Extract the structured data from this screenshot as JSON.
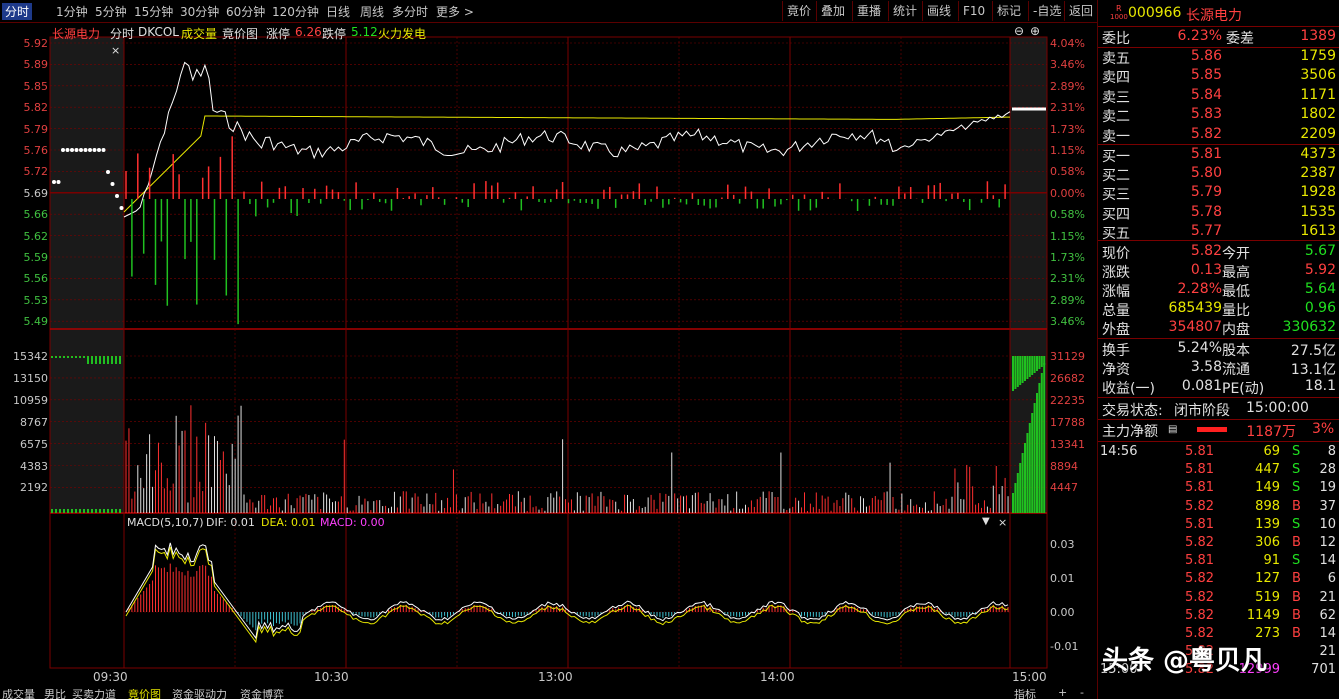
{
  "toolbar": {
    "periods": [
      "分时",
      "1分钟",
      "5分钟",
      "15分钟",
      "30分钟",
      "60分钟",
      "120分钟",
      "日线",
      "周线",
      "多分时",
      "更多 >"
    ],
    "buttons": [
      "竟价",
      "叠加",
      "重播",
      "统计",
      "画线",
      "F10",
      "标记",
      "-自选",
      "返回"
    ]
  },
  "chart_header": {
    "stock_name": "长源电力",
    "mode": "分时",
    "indicator": "DKCOL",
    "vol_label": "成交量",
    "bid_label": "竟价图",
    "limit_up_label": "涨停",
    "limit_up_value": "6.26",
    "limit_down_label": "跌停",
    "limit_down_value": "5.12",
    "concept": "火力发电"
  },
  "price_axis": {
    "left": [
      "5.92",
      "5.89",
      "5.85",
      "5.82",
      "5.79",
      "5.76",
      "5.72",
      "5.69",
      "5.66",
      "5.62",
      "5.59",
      "5.56",
      "5.53",
      "5.49"
    ],
    "right": [
      "4.04%",
      "3.46%",
      "2.89%",
      "2.31%",
      "1.73%",
      "1.15%",
      "0.58%",
      "0.00%",
      "0.58%",
      "1.15%",
      "1.73%",
      "2.31%",
      "2.89%",
      "3.46%"
    ]
  },
  "volume_axis": {
    "left": [
      "15342",
      "13150",
      "10959",
      "8767",
      "6575",
      "4383",
      "2192"
    ],
    "right": [
      "31129",
      "26682",
      "22235",
      "17788",
      "13341",
      "8894",
      "4447"
    ]
  },
  "macd": {
    "label": "MACD(5,10,7)",
    "dif": "DIF: 0.01",
    "dea": "DEA: 0.01",
    "macd": "MACD: 0.00",
    "axis": [
      "0.03",
      "0.01",
      "0.00",
      "-0.01"
    ]
  },
  "time_axis": [
    "09:30",
    "10:30",
    "13:00",
    "14:00",
    "15:00"
  ],
  "bottom_tabs": [
    "成交量",
    "男比",
    "买卖力道",
    "竟价图",
    "资金驱动力",
    "资金博弈"
  ],
  "bottom_right": [
    "指标",
    "+",
    "-"
  ],
  "panel": {
    "code": "000966",
    "name": "长源电力",
    "code_prefix": "R",
    "code_sub": "1000",
    "weibi_label": "委比",
    "weibi": "6.23%",
    "weicha_label": "委差",
    "weicha": "1389",
    "asks": [
      {
        "label": "卖五",
        "price": "5.86",
        "vol": "1759"
      },
      {
        "label": "卖四",
        "price": "5.85",
        "vol": "3506"
      },
      {
        "label": "卖三",
        "price": "5.84",
        "vol": "1171"
      },
      {
        "label": "卖二",
        "price": "5.83",
        "vol": "1802"
      },
      {
        "label": "卖一",
        "price": "5.82",
        "vol": "2209"
      }
    ],
    "bids": [
      {
        "label": "买一",
        "price": "5.81",
        "vol": "4373"
      },
      {
        "label": "买二",
        "price": "5.80",
        "vol": "2387"
      },
      {
        "label": "买三",
        "price": "5.79",
        "vol": "1928"
      },
      {
        "label": "买四",
        "price": "5.78",
        "vol": "1535"
      },
      {
        "label": "买五",
        "price": "5.77",
        "vol": "1613"
      }
    ],
    "stats": [
      {
        "l1": "现价",
        "v1": "5.82",
        "l2": "今开",
        "v2": "5.67",
        "c1": "red",
        "c2": "grn"
      },
      {
        "l1": "涨跌",
        "v1": "0.13",
        "l2": "最高",
        "v2": "5.92",
        "c1": "red",
        "c2": "red"
      },
      {
        "l1": "涨幅",
        "v1": "2.28%",
        "l2": "最低",
        "v2": "5.64",
        "c1": "red",
        "c2": "grn"
      },
      {
        "l1": "总量",
        "v1": "685439",
        "l2": "量比",
        "v2": "0.96",
        "c1": "yel",
        "c2": "grn"
      },
      {
        "l1": "外盘",
        "v1": "354807",
        "l2": "内盘",
        "v2": "330632",
        "c1": "red",
        "c2": "grn"
      }
    ],
    "fund": [
      {
        "l1": "换手",
        "v1": "5.24%",
        "l2": "股本",
        "v2": "27.5亿"
      },
      {
        "l1": "净资",
        "v1": "3.58",
        "l2": "流通",
        "v2": "13.1亿"
      },
      {
        "l1": "收益(一)",
        "v1": "0.081",
        "l2": "PE(动)",
        "v2": "18.1"
      }
    ],
    "trade_status_label": "交易状态:",
    "trade_status": "闭市阶段",
    "trade_time": "15:00:00",
    "main_flow_label": "主力净额",
    "main_flow_value": "1187万",
    "main_flow_pct": "3%",
    "ticks": [
      {
        "time": "14:56",
        "price": "5.81",
        "vol": "69",
        "side": "S",
        "n": "8"
      },
      {
        "time": "",
        "price": "5.81",
        "vol": "447",
        "side": "S",
        "n": "28"
      },
      {
        "time": "",
        "price": "5.81",
        "vol": "149",
        "side": "S",
        "n": "19"
      },
      {
        "time": "",
        "price": "5.82",
        "vol": "898",
        "side": "B",
        "n": "37"
      },
      {
        "time": "",
        "price": "5.81",
        "vol": "139",
        "side": "S",
        "n": "10"
      },
      {
        "time": "",
        "price": "5.82",
        "vol": "306",
        "side": "B",
        "n": "12"
      },
      {
        "time": "",
        "price": "5.81",
        "vol": "91",
        "side": "S",
        "n": "14"
      },
      {
        "time": "",
        "price": "5.82",
        "vol": "127",
        "side": "B",
        "n": "6"
      },
      {
        "time": "",
        "price": "5.82",
        "vol": "519",
        "side": "B",
        "n": "21"
      },
      {
        "time": "",
        "price": "5.82",
        "vol": "1149",
        "side": "B",
        "n": "62"
      },
      {
        "time": "",
        "price": "5.82",
        "vol": "273",
        "side": "B",
        "n": "14"
      },
      {
        "time": "",
        "price": "5.82",
        "vol": "",
        "side": "",
        "n": "21"
      },
      {
        "time": "15:00",
        "price": "5.82",
        "vol": "12999",
        "side": "",
        "n": "701"
      }
    ]
  },
  "watermark": "头条 @粤贝凡",
  "colors": {
    "up": "#ff4040",
    "down": "#20e020",
    "grid": "#7a0000",
    "avg": "#e8e800",
    "price": "#ffffff"
  }
}
